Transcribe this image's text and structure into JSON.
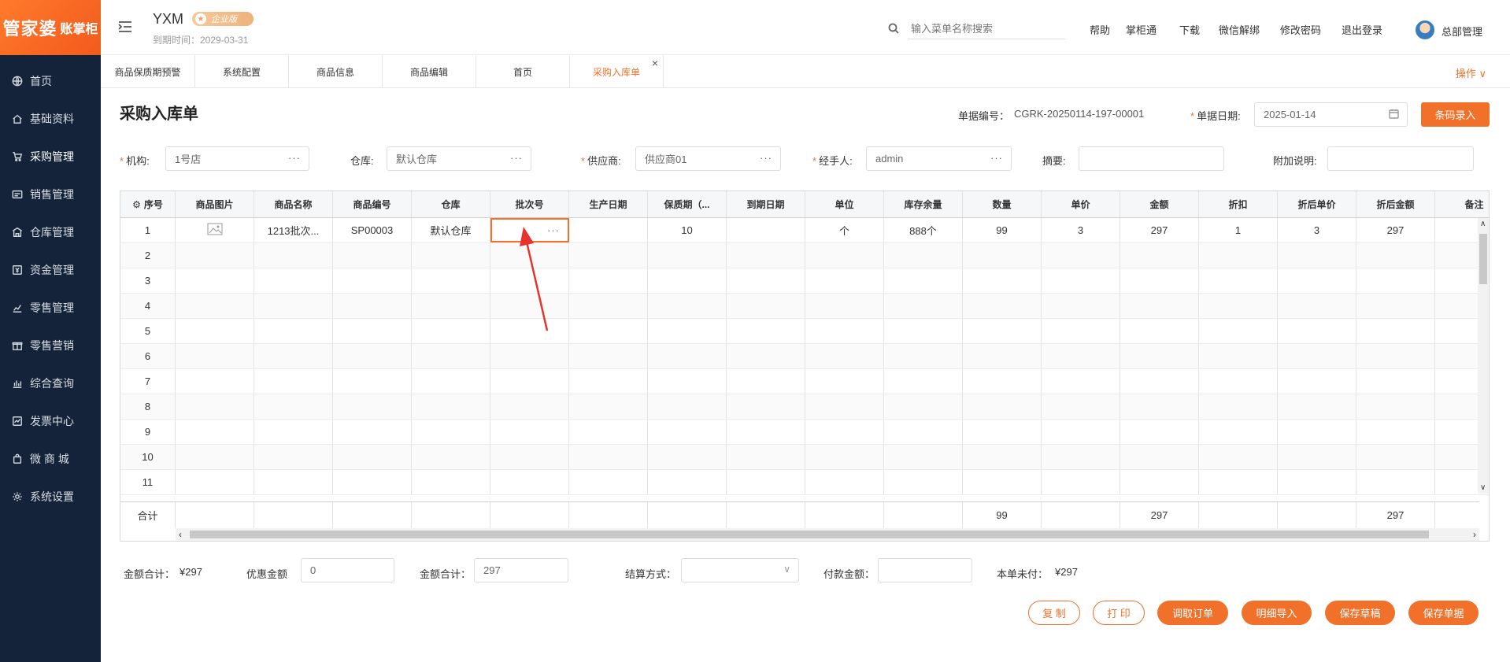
{
  "app": {
    "logo_text": "管家婆",
    "logo_sub": "账掌柜",
    "company": "YXM",
    "edition": "企业版",
    "expire_text": "到期时间：2029-03-31",
    "search_placeholder": "输入菜单名称搜索",
    "header_links": [
      "帮助",
      "掌柜通",
      "下载",
      "微信解绑",
      "修改密码",
      "退出登录"
    ],
    "user_name": "总部管理"
  },
  "sidebar": {
    "items": [
      {
        "label": "首页",
        "icon": "globe-icon"
      },
      {
        "label": "基础资料",
        "icon": "home-icon"
      },
      {
        "label": "采购管理",
        "icon": "cart-icon"
      },
      {
        "label": "销售管理",
        "icon": "sales-icon"
      },
      {
        "label": "仓库管理",
        "icon": "warehouse-icon"
      },
      {
        "label": "资金管理",
        "icon": "money-icon"
      },
      {
        "label": "零售管理",
        "icon": "retail-icon"
      },
      {
        "label": "零售营销",
        "icon": "gift-icon"
      },
      {
        "label": "综合查询",
        "icon": "bar-chart-icon"
      },
      {
        "label": "发票中心",
        "icon": "invoice-icon"
      },
      {
        "label": "微 商 城",
        "icon": "bag-icon"
      },
      {
        "label": "系统设置",
        "icon": "gear-icon"
      }
    ]
  },
  "tabs": [
    {
      "label": "商品保质期预警"
    },
    {
      "label": "系统配置"
    },
    {
      "label": "商品信息"
    },
    {
      "label": "商品编辑"
    },
    {
      "label": "首页"
    },
    {
      "label": "采购入库单"
    }
  ],
  "ops_label": "操作",
  "page": {
    "title": "采购入库单",
    "doc_no_label": "单据编号：",
    "doc_no": "CGRK-20250114-197-00001",
    "doc_date_label": "单据日期:",
    "doc_date": "2025-01-14",
    "barcode_btn": "条码录入",
    "org_label": "机构:",
    "org": "1号店",
    "warehouse_label": "仓库:",
    "warehouse": "默认仓库",
    "supplier_label": "供应商:",
    "supplier": "供应商01",
    "handler_label": "经手人:",
    "handler": "admin",
    "summary_label": "摘要:",
    "summary": "",
    "note_label": "附加说明:",
    "note": ""
  },
  "grid": {
    "columns": [
      "序号",
      "商品图片",
      "商品名称",
      "商品编号",
      "仓库",
      "批次号",
      "生产日期",
      "保质期（...",
      "到期日期",
      "单位",
      "库存余量",
      "数量",
      "单价",
      "金额",
      "折扣",
      "折后单价",
      "折后金额",
      "备注"
    ],
    "rows": [
      [
        "1",
        "",
        "1213批次...",
        "SP00003",
        "默认仓库",
        "",
        "",
        "10",
        "",
        "个",
        "888个",
        "99",
        "3",
        "297",
        "1",
        "3",
        "297",
        ""
      ],
      [
        "2"
      ],
      [
        "3"
      ],
      [
        "4"
      ],
      [
        "5"
      ],
      [
        "6"
      ],
      [
        "7"
      ],
      [
        "8"
      ],
      [
        "9"
      ],
      [
        "10"
      ],
      [
        "11"
      ]
    ],
    "total_label": "合计",
    "total_qty": "99",
    "total_amount": "297",
    "total_disc_amount": "297"
  },
  "footer": {
    "amount_total_label": "金额合计：",
    "amount_total": "¥297",
    "discount_label": "优惠金额",
    "discount": "0",
    "amount_total2_label": "金额合计：",
    "amount_total2": "297",
    "settle_label": "结算方式：",
    "settle": "",
    "pay_label": "付款金额：",
    "pay": "",
    "unpaid_label": "本单未付：",
    "unpaid": "¥297",
    "buttons": [
      "复 制",
      "打 印",
      "调取订单",
      "明细导入",
      "保存草稿",
      "保存单据"
    ]
  },
  "colors": {
    "accent": "#f2712a",
    "sidebar_bg": "#14233a"
  }
}
